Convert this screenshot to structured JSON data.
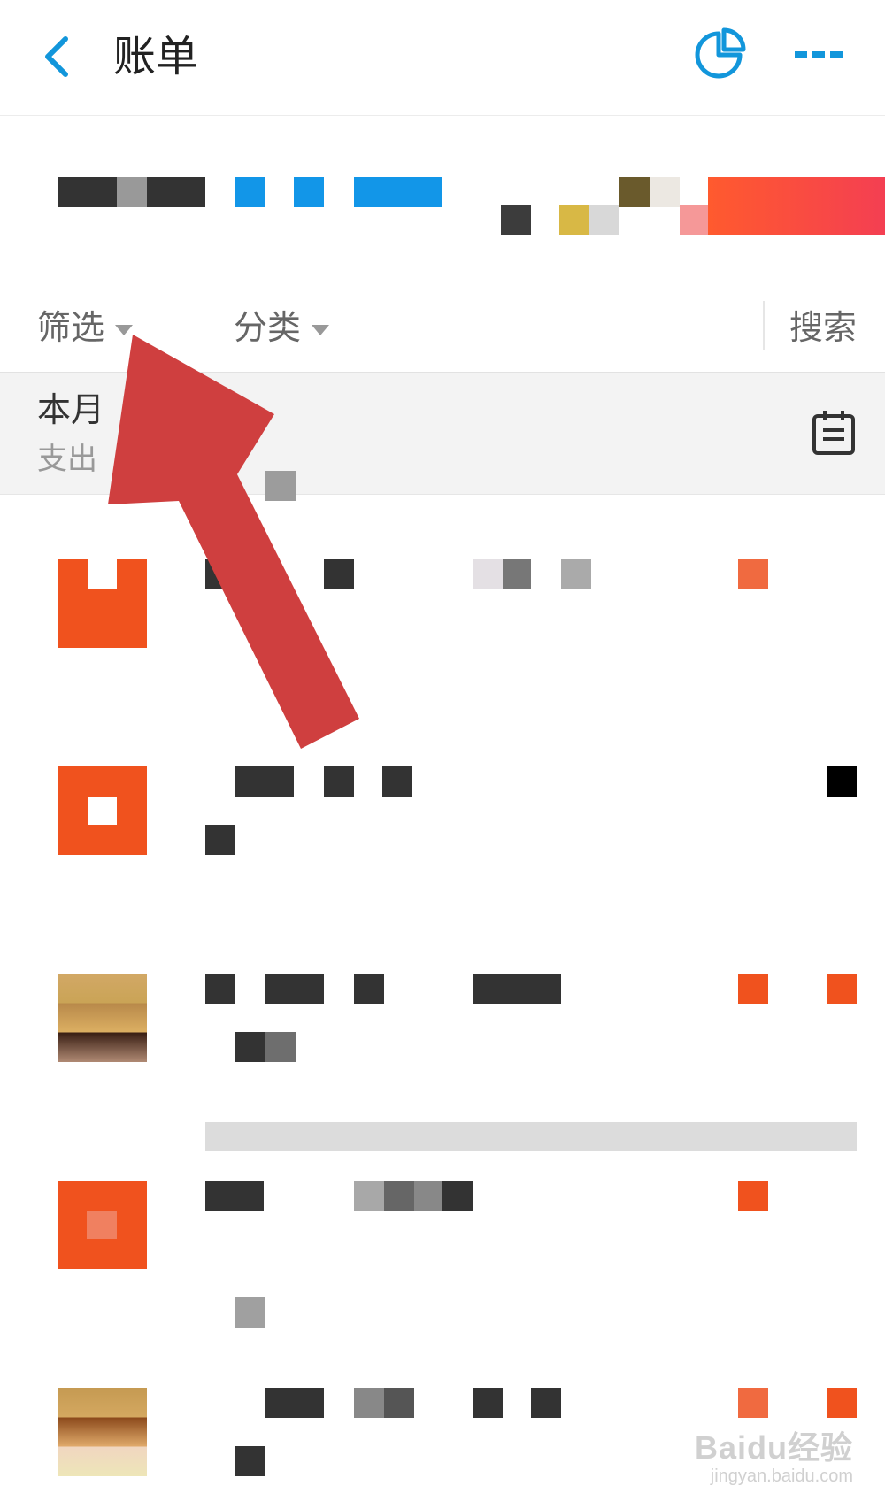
{
  "header": {
    "title": "账单",
    "accent_color": "#1296db"
  },
  "filters": {
    "filter_label": "筛选",
    "category_label": "分类",
    "search_label": "搜索"
  },
  "month": {
    "label": "本月",
    "expense_label": "支出"
  },
  "transactions": [
    {
      "icon_colors": [
        "#f0521e"
      ]
    },
    {
      "icon_colors": [
        "#f0521e"
      ]
    },
    {
      "icon_colors": [
        "#c9a16a"
      ]
    },
    {
      "icon_colors": [
        "#f0521e"
      ]
    },
    {
      "icon_colors": [
        "#c59a52"
      ]
    }
  ],
  "watermark": {
    "brand": "Baidu经验",
    "url": "jingyan.baidu.com"
  },
  "colors": {
    "brand_orange": "#f0521e",
    "arrow_red": "#cf3f3f"
  }
}
